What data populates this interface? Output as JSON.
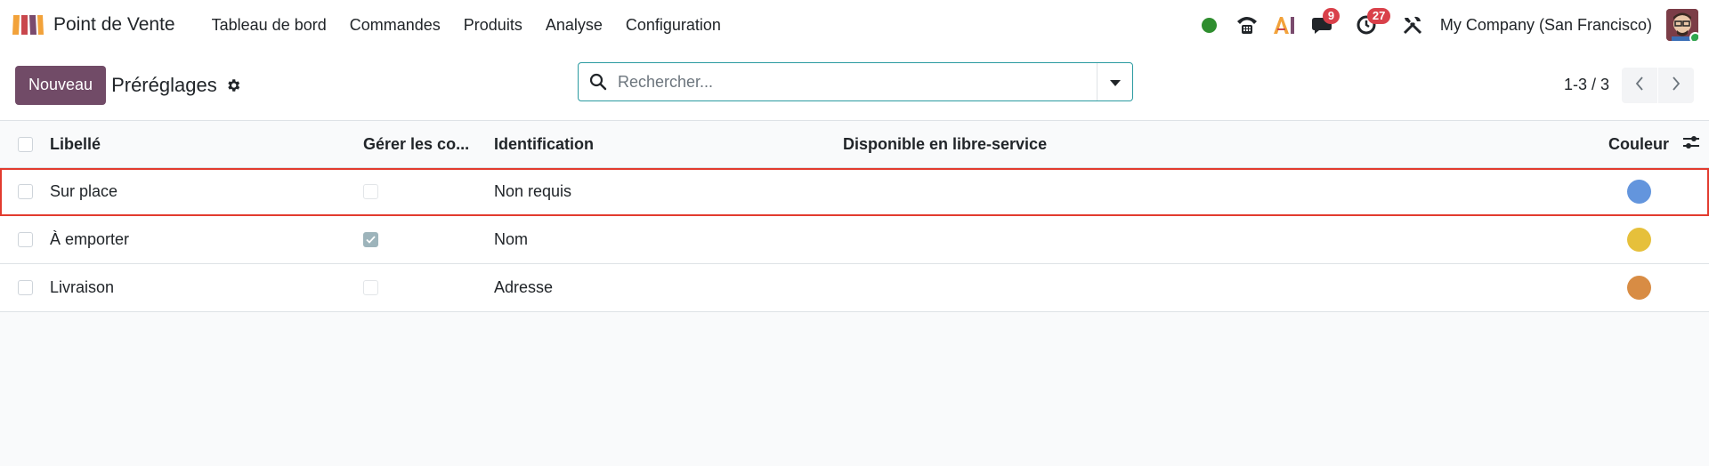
{
  "navbar": {
    "app_name": "Point de Vente",
    "menu": [
      "Tableau de bord",
      "Commandes",
      "Produits",
      "Analyse",
      "Configuration"
    ],
    "messages_badge": "9",
    "activities_badge": "27",
    "company": "My Company (San Francisco)",
    "status_color": "#2f8e2f"
  },
  "control": {
    "new_label": "Nouveau",
    "title": "Préréglages",
    "search_placeholder": "Rechercher...",
    "pager": "1-3 / 3"
  },
  "table": {
    "headers": {
      "label": "Libellé",
      "manage": "Gérer les co...",
      "ident": "Identification",
      "avail": "Disponible en libre-service",
      "color": "Couleur"
    },
    "rows": [
      {
        "label": "Sur place",
        "manage": false,
        "ident": "Non requis",
        "available": true,
        "color": "#6395dd"
      },
      {
        "label": "À emporter",
        "manage": true,
        "ident": "Nom",
        "available": true,
        "color": "#e6c03b"
      },
      {
        "label": "Livraison",
        "manage": false,
        "ident": "Adresse",
        "available": true,
        "color": "#d88c44"
      }
    ]
  },
  "colors": {
    "brand": "#714b67",
    "toggle_on": "#3d9a45",
    "selection_outline": "#e23b2e"
  }
}
